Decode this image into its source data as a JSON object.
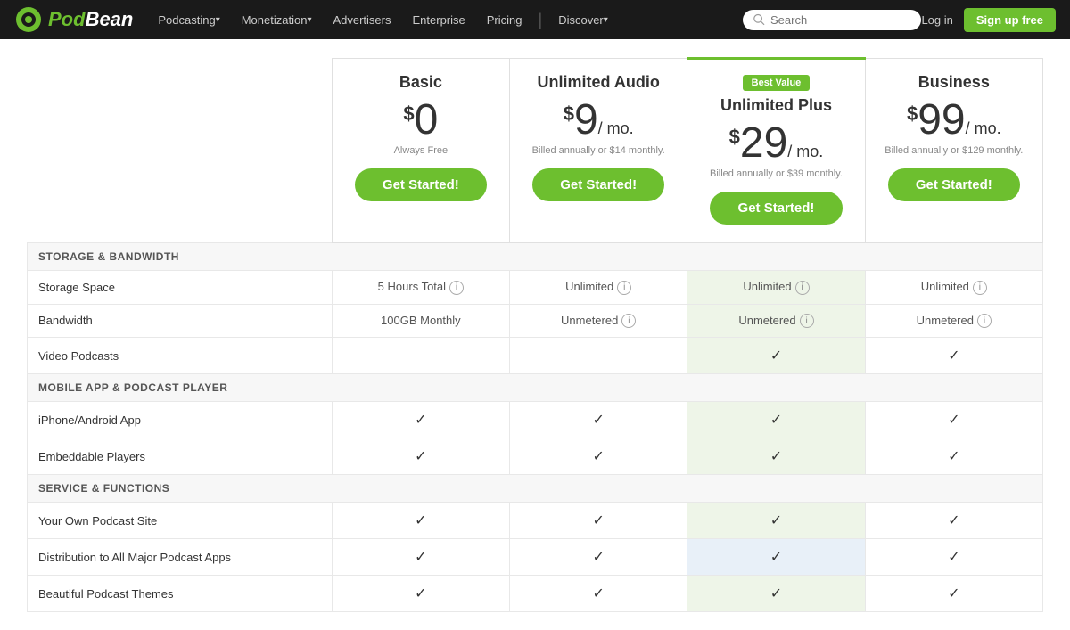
{
  "nav": {
    "logo_text": "Pod",
    "logo_highlight": "Bean",
    "items": [
      {
        "label": "Podcasting",
        "has_arrow": true
      },
      {
        "label": "Monetization",
        "has_arrow": true
      },
      {
        "label": "Advertisers",
        "has_arrow": false
      },
      {
        "label": "Enterprise",
        "has_arrow": false
      },
      {
        "label": "Pricing",
        "has_arrow": false
      }
    ],
    "discover": "Discover",
    "search_placeholder": "Search",
    "login_label": "Log in",
    "signup_label": "Sign up free"
  },
  "plans": [
    {
      "id": "basic",
      "name": "Basic",
      "price_dollar": "$",
      "price_amount": "0",
      "price_per": "",
      "price_note": "Always Free",
      "best_value": false,
      "cta": "Get Started!"
    },
    {
      "id": "unlimited-audio",
      "name": "Unlimited Audio",
      "price_dollar": "$",
      "price_amount": "9",
      "price_per": "/ mo.",
      "price_note": "Billed annually or $14 monthly.",
      "best_value": false,
      "cta": "Get Started!"
    },
    {
      "id": "unlimited-plus",
      "name": "Unlimited Plus",
      "price_dollar": "$",
      "price_amount": "29",
      "price_per": "/ mo.",
      "price_note": "Billed annually or $39 monthly.",
      "best_value": true,
      "best_value_label": "Best Value",
      "cta": "Get Started!"
    },
    {
      "id": "business",
      "name": "Business",
      "price_dollar": "$",
      "price_amount": "99",
      "price_per": "/ mo.",
      "price_note": "Billed annually or $129 monthly.",
      "best_value": false,
      "cta": "Get Started!"
    }
  ],
  "sections": [
    {
      "section_label": "STORAGE & BANDWIDTH",
      "rows": [
        {
          "feature": "Storage Space",
          "values": [
            {
              "text": "5 Hours Total",
              "info": true,
              "check": false
            },
            {
              "text": "Unlimited",
              "info": true,
              "check": false
            },
            {
              "text": "Unlimited",
              "info": true,
              "check": false
            },
            {
              "text": "Unlimited",
              "info": true,
              "check": false
            }
          ]
        },
        {
          "feature": "Bandwidth",
          "values": [
            {
              "text": "100GB Monthly",
              "info": false,
              "check": false
            },
            {
              "text": "Unmetered",
              "info": true,
              "check": false
            },
            {
              "text": "Unmetered",
              "info": true,
              "check": false
            },
            {
              "text": "Unmetered",
              "info": true,
              "check": false
            }
          ]
        },
        {
          "feature": "Video Podcasts",
          "values": [
            {
              "text": "",
              "info": false,
              "check": false
            },
            {
              "text": "",
              "info": false,
              "check": false
            },
            {
              "text": "",
              "info": false,
              "check": true
            },
            {
              "text": "",
              "info": false,
              "check": true
            }
          ]
        }
      ]
    },
    {
      "section_label": "MOBILE APP & PODCAST PLAYER",
      "rows": [
        {
          "feature": "iPhone/Android App",
          "values": [
            {
              "text": "",
              "info": false,
              "check": true
            },
            {
              "text": "",
              "info": false,
              "check": true
            },
            {
              "text": "",
              "info": false,
              "check": true
            },
            {
              "text": "",
              "info": false,
              "check": true
            }
          ]
        },
        {
          "feature": "Embeddable Players",
          "values": [
            {
              "text": "",
              "info": false,
              "check": true
            },
            {
              "text": "",
              "info": false,
              "check": true
            },
            {
              "text": "",
              "info": false,
              "check": true
            },
            {
              "text": "",
              "info": false,
              "check": true
            }
          ]
        }
      ]
    },
    {
      "section_label": "SERVICE & FUNCTIONS",
      "rows": [
        {
          "feature": "Your Own Podcast Site",
          "values": [
            {
              "text": "",
              "info": false,
              "check": true
            },
            {
              "text": "",
              "info": false,
              "check": true
            },
            {
              "text": "",
              "info": false,
              "check": true
            },
            {
              "text": "",
              "info": false,
              "check": true
            }
          ]
        },
        {
          "feature": "Distribution to All Major Podcast Apps",
          "values": [
            {
              "text": "",
              "info": false,
              "check": true
            },
            {
              "text": "",
              "info": false,
              "check": true
            },
            {
              "text": "",
              "info": false,
              "check": true,
              "highlighted_row": true
            },
            {
              "text": "",
              "info": false,
              "check": true
            }
          ],
          "highlighted_row": true
        },
        {
          "feature": "Beautiful Podcast Themes",
          "values": [
            {
              "text": "",
              "info": false,
              "check": true
            },
            {
              "text": "",
              "info": false,
              "check": true
            },
            {
              "text": "",
              "info": false,
              "check": true
            },
            {
              "text": "",
              "info": false,
              "check": true
            }
          ]
        }
      ]
    }
  ]
}
